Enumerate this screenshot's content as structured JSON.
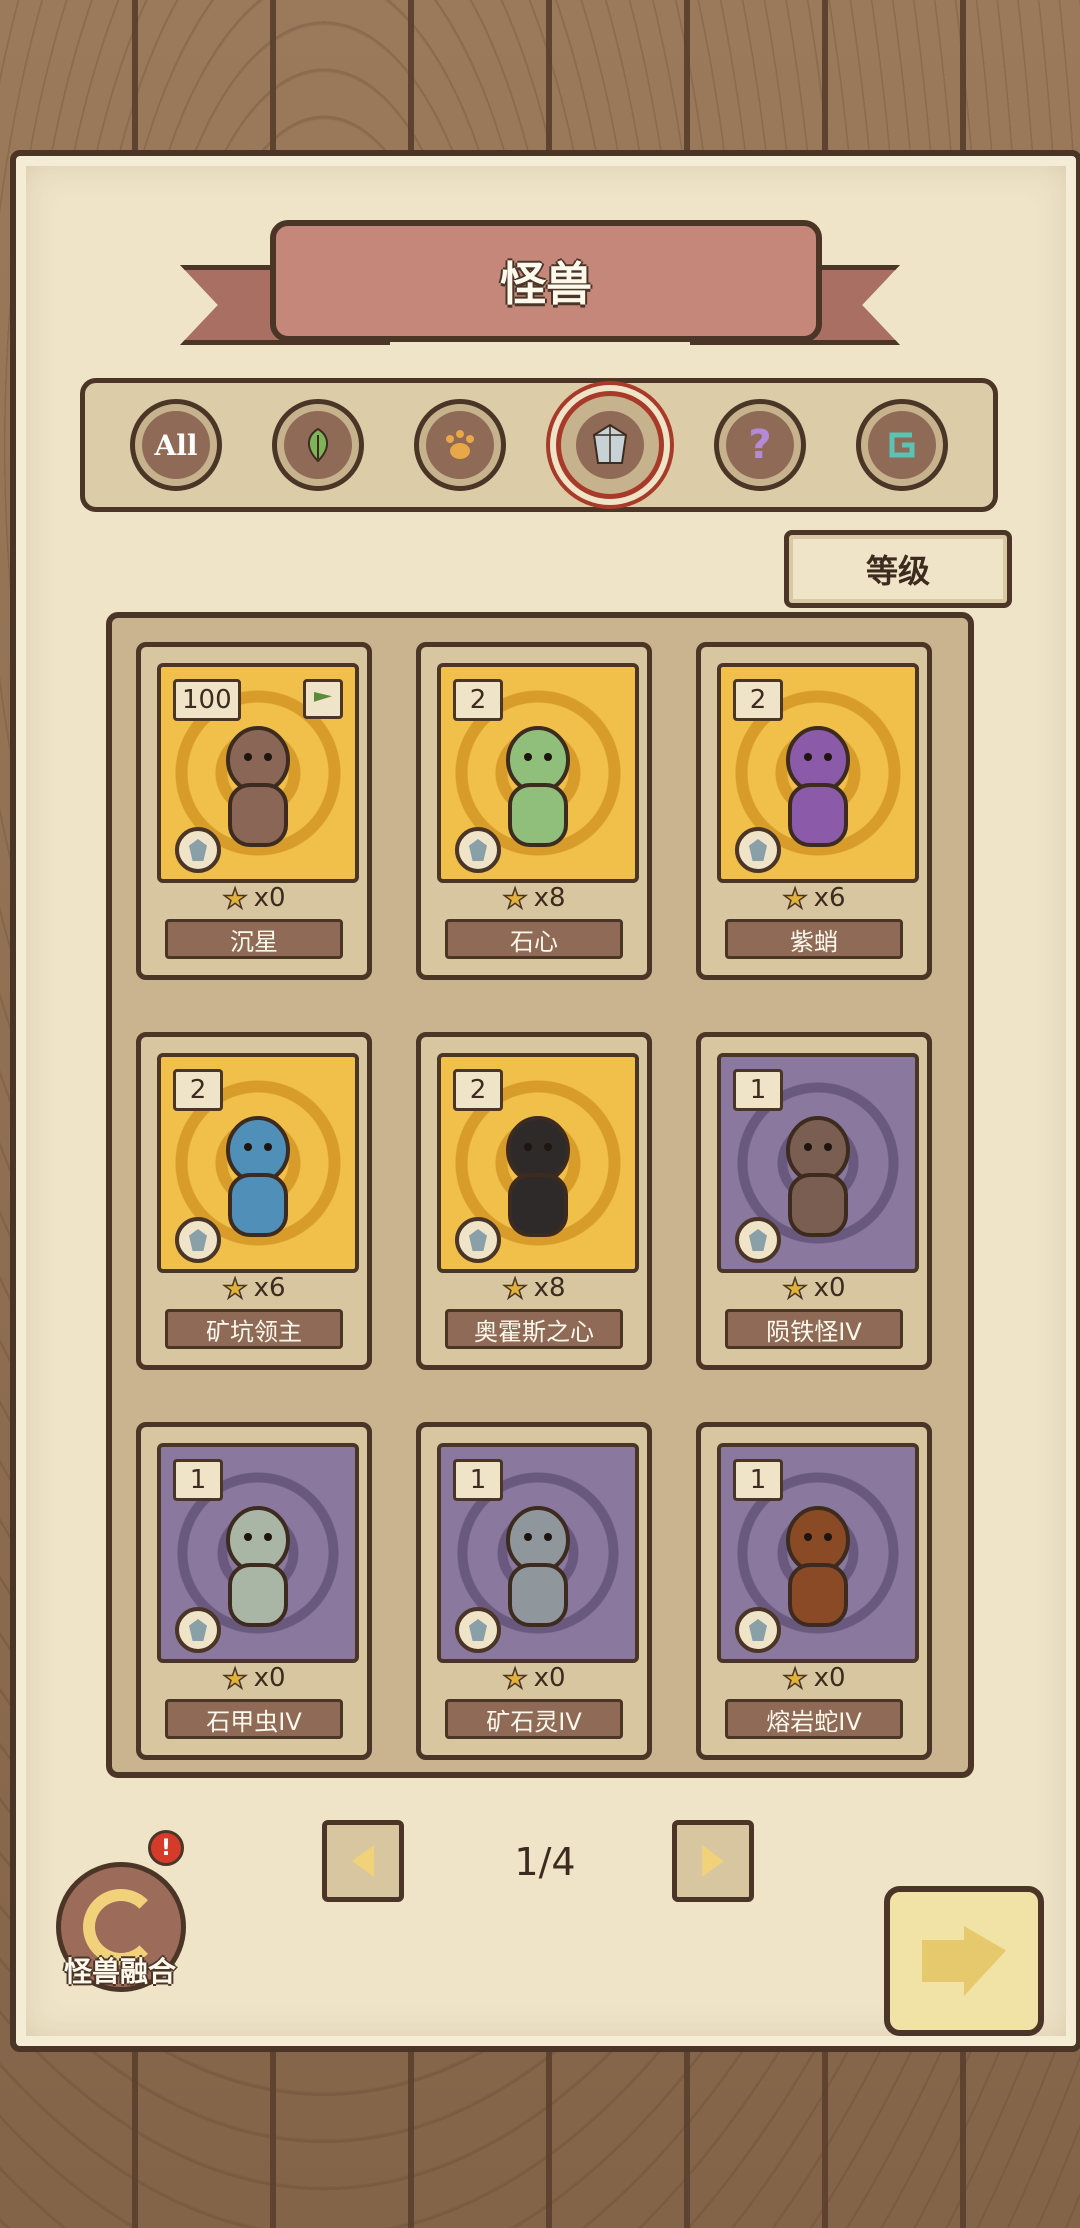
{
  "header": {
    "title": "怪兽"
  },
  "filters": [
    {
      "name": "all",
      "label": "All",
      "icon": "all-text-icon",
      "active": false
    },
    {
      "name": "plant",
      "label": "",
      "icon": "leaf-icon",
      "active": false
    },
    {
      "name": "beast",
      "label": "",
      "icon": "paw-icon",
      "active": false
    },
    {
      "name": "mineral",
      "label": "",
      "icon": "crystal-icon",
      "active": true
    },
    {
      "name": "mystery",
      "label": "",
      "icon": "question-mark-icon",
      "active": false
    },
    {
      "name": "special",
      "label": "",
      "icon": "swirl-rune-icon",
      "active": false
    }
  ],
  "sort": {
    "label": "等级"
  },
  "cards": [
    {
      "level": "100",
      "count": "x0",
      "name": "沉星",
      "bg": "gold",
      "has_flag": true,
      "monster_color": "#8a6656"
    },
    {
      "level": "2",
      "count": "x8",
      "name": "石心",
      "bg": "gold",
      "has_flag": false,
      "monster_color": "#8fbf7a"
    },
    {
      "level": "2",
      "count": "x6",
      "name": "紫蛸",
      "bg": "gold",
      "has_flag": false,
      "monster_color": "#8b5aa8"
    },
    {
      "level": "2",
      "count": "x6",
      "name": "矿坑领主",
      "bg": "gold",
      "has_flag": false,
      "monster_color": "#4f8fb8"
    },
    {
      "level": "2",
      "count": "x8",
      "name": "奥霍斯之心",
      "bg": "gold",
      "has_flag": false,
      "monster_color": "#2f2a2a"
    },
    {
      "level": "1",
      "count": "x0",
      "name": "陨铁怪IV",
      "bg": "purple",
      "has_flag": false,
      "monster_color": "#7a5e52"
    },
    {
      "level": "1",
      "count": "x0",
      "name": "石甲虫IV",
      "bg": "purple",
      "has_flag": false,
      "monster_color": "#a9b6a6"
    },
    {
      "level": "1",
      "count": "x0",
      "name": "矿石灵IV",
      "bg": "purple",
      "has_flag": false,
      "monster_color": "#8f969c"
    },
    {
      "level": "1",
      "count": "x0",
      "name": "熔岩蛇IV",
      "bg": "purple",
      "has_flag": false,
      "monster_color": "#8a4a26"
    }
  ],
  "pagination": {
    "current": "1/4"
  },
  "fusion": {
    "label": "怪兽融合",
    "alert": "!"
  },
  "colors": {
    "parchment": "#efe4c8",
    "outline": "#4a3526",
    "ribbon": "#c4877a",
    "gold_bg": "#f1c04a",
    "purple_bg": "#8a789f"
  }
}
